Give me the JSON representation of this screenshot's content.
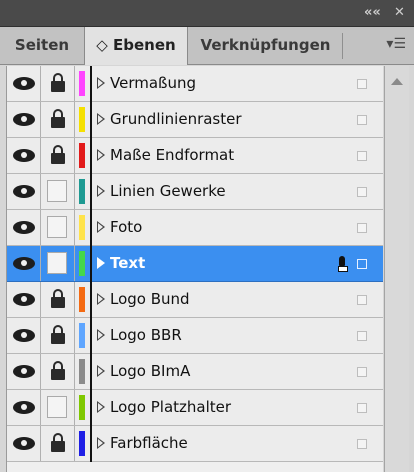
{
  "panel": {
    "tabs": [
      {
        "label": "Seiten"
      },
      {
        "label": "◇ Ebenen"
      },
      {
        "label": "Verknüpfungen"
      }
    ],
    "layers": [
      {
        "name": "Vermaßung",
        "visible": true,
        "locked": true,
        "color": "#ff44ff",
        "selected": false
      },
      {
        "name": "Grundlinienraster",
        "visible": true,
        "locked": true,
        "color": "#f5e000",
        "selected": false
      },
      {
        "name": "Maße Endformat",
        "visible": true,
        "locked": true,
        "color": "#e21a1a",
        "selected": false
      },
      {
        "name": "Linien Gewerke",
        "visible": true,
        "locked": false,
        "color": "#1e9a92",
        "selected": false
      },
      {
        "name": "Foto",
        "visible": true,
        "locked": false,
        "color": "#ffe34a",
        "selected": false
      },
      {
        "name": "Text",
        "visible": true,
        "locked": false,
        "color": "#45d84a",
        "selected": true
      },
      {
        "name": "Logo Bund",
        "visible": true,
        "locked": true,
        "color": "#f46a12",
        "selected": false
      },
      {
        "name": "Logo BBR",
        "visible": true,
        "locked": true,
        "color": "#5fa6ff",
        "selected": false
      },
      {
        "name": "Logo BImA",
        "visible": true,
        "locked": true,
        "color": "#8b8b8b",
        "selected": false
      },
      {
        "name": "Logo Platzhalter",
        "visible": true,
        "locked": false,
        "color": "#7fc800",
        "selected": false
      },
      {
        "name": "Farbfläche",
        "visible": true,
        "locked": true,
        "color": "#1e1ee5",
        "selected": false
      }
    ]
  }
}
